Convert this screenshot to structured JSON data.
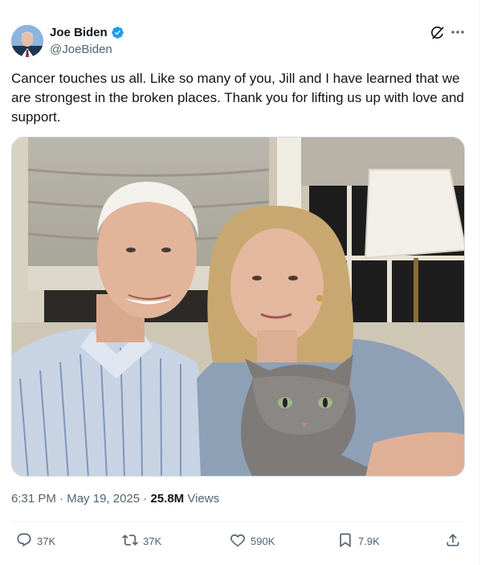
{
  "author": {
    "name": "Joe Biden",
    "handle": "@JoeBiden",
    "verified_color": "#1d9bf0"
  },
  "header_icons": {
    "grok": "grok-icon",
    "more": "more-options-icon"
  },
  "tweet": {
    "text": "Cancer touches us all. Like so many of you, Jill and I have learned that we are strongest in the broken places. Thank you for lifting us up with love and support."
  },
  "meta": {
    "time": "6:31 PM",
    "date": "May 19, 2025",
    "views_count": "25.8M",
    "views_label": "Views",
    "sep": "·"
  },
  "actions": {
    "replies": "37K",
    "reposts": "37K",
    "likes": "590K",
    "bookmarks": "7.9K"
  },
  "colors": {
    "text": "#0f1419",
    "secondary": "#536471",
    "border": "#cfd9de"
  }
}
